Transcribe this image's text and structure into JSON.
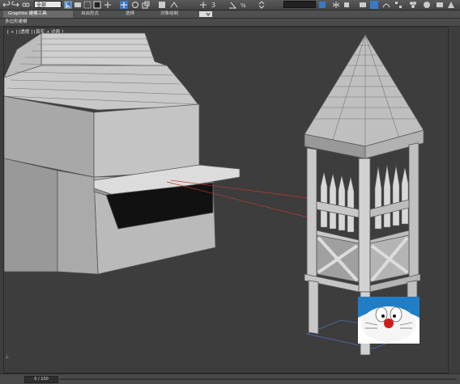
{
  "toolbar": {
    "dropdown_left": "全部",
    "dropdown_right": "",
    "icons": [
      "undo-icon",
      "redo-icon",
      "link-icon",
      "unlink-icon",
      "select-icon",
      "select-region-icon",
      "move-icon",
      "rotate-icon",
      "scale-icon",
      "snap-icon",
      "render-icon"
    ]
  },
  "ribbon": {
    "tabs": [
      "Graphite 建模工具",
      "自由形式",
      "选择",
      "对象绘制"
    ]
  },
  "subribbon": {
    "label": "多边形建模"
  },
  "viewport": {
    "label": "[ + ] [透视 ] [真实 + 边面 ]"
  },
  "status": {
    "frame": "0 / 100"
  },
  "overlay": {
    "character": "doraemon-avatar"
  },
  "colors": {
    "viewport_bg": "#3d3d3d",
    "model_grey": "#b9b9b9",
    "selection_line": "#c0392b",
    "grid_blue": "#4a6fb5"
  }
}
